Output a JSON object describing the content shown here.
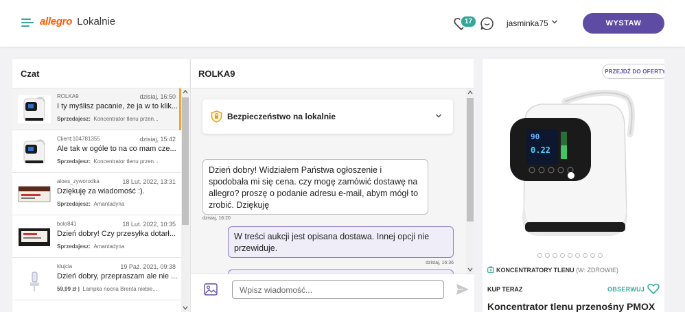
{
  "header": {
    "logo_brand": "allegro",
    "logo_sub": "Lokalnie",
    "favorites_count": "17",
    "username": "jasminka75",
    "publish_label": "WYSTAW"
  },
  "chatlist": {
    "title": "Czat",
    "items": [
      {
        "sender": "ROLKA9",
        "date": "dzisiaj, 16:50",
        "message": "I ty myślisz pacanie, że ja w to klik...",
        "meta_label": "Sprzedajesz:",
        "meta_value": "Koncentrator tlenu przen..."
      },
      {
        "sender": "Client:104781355",
        "date": "dzisiaj, 15:42",
        "message": "Ale tak w ogóle to na co mam cze...",
        "meta_label": "Sprzedajesz:",
        "meta_value": "Koncentrator tlenu przen..."
      },
      {
        "sender": "aloes_zyworodka",
        "date": "18 Lut. 2022, 13:31",
        "message": "Dziękuję za wiadomość :).",
        "meta_label": "Sprzedajesz:",
        "meta_value": "Amantadyna"
      },
      {
        "sender": "bolo841",
        "date": "18 Lut. 2022, 10:35",
        "message": "Dzień dobry! Czy przesyłka dotarł...",
        "meta_label": "Sprzedajesz:",
        "meta_value": "Amantadyna"
      },
      {
        "sender": "klujcia",
        "date": "19 Paź. 2021, 09:38",
        "message": "Dzień dobry, przepraszam ale nie ...",
        "meta_label": "59,99 zł |",
        "meta_value": "Lampka nocna Brenta niebie..."
      }
    ]
  },
  "conversation": {
    "title": "ROLKA9",
    "safety_label": "Bezpieczeństwo na lokalnie",
    "incoming_text": "Dzień dobry! Widziałem Państwa ogłoszenie i spodobała mi się cena. czy mogę zamówić dostawę na allegro? proszę o podanie adresu e-mail, abym mógł to zrobić. Dziękuję",
    "incoming_time": "dzisiaj, 16:20",
    "outgoing_text": "W treści aukcji jest opisana dostawa. Innej opcji nie przewiduje.",
    "outgoing_time": "dzisiaj, 16:36",
    "input_placeholder": "Wpisz wiadomość..."
  },
  "offer": {
    "goto_label": "PRZEJDŹ DO OFERTY",
    "display_time": "90",
    "display_flow": "0.22",
    "category": "KONCENTRATORY TLENU",
    "category_parent": "(W: ZDROWIE)",
    "buy_now": "KUP TERAZ",
    "follow": "OBSERWUJ",
    "title_partial": "Koncentrator tlenu przenośny PMOX"
  },
  "colors": {
    "accent": "#5e4ba4",
    "teal": "#33a89a",
    "active_marker": "#f2a52b"
  },
  "icons": [
    "menu-icon",
    "heart-icon",
    "chat-bubble-icon",
    "chevron-down-icon",
    "shield-icon",
    "image-icon",
    "send-icon",
    "category-icon"
  ]
}
